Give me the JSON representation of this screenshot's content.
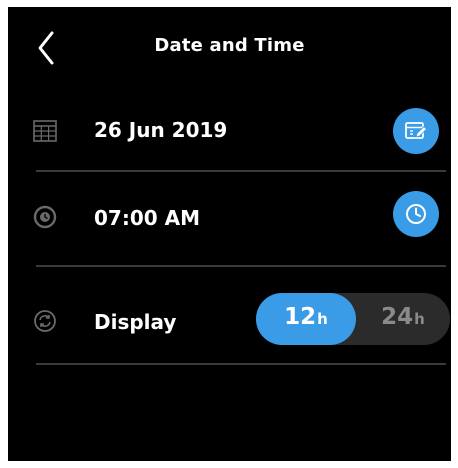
{
  "header": {
    "title": "Date and Time",
    "back_icon": "chevron-left-icon"
  },
  "date_row": {
    "icon": "calendar-icon",
    "value": "26 Jun 2019",
    "edit_icon": "calendar-edit-icon"
  },
  "time_row": {
    "icon": "clock-icon",
    "value": "07:00 AM",
    "edit_icon": "clock-icon"
  },
  "display_row": {
    "icon": "refresh-icon",
    "label": "Display",
    "options": [
      {
        "number": "12",
        "unit": "h",
        "selected": true
      },
      {
        "number": "24",
        "unit": "h",
        "selected": false
      }
    ]
  },
  "colors": {
    "background": "#000000",
    "accent": "#3a9be6",
    "text": "#ffffff",
    "inactive_text": "#8a8a8a",
    "toggle_track": "#2b2b2b",
    "divider": "#3a3a3a"
  }
}
